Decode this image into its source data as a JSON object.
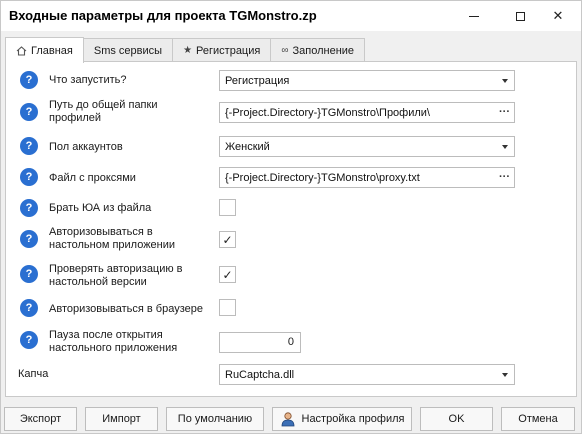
{
  "window": {
    "title": "Входные параметры для проекта TGMonstro.zp"
  },
  "tabs": [
    {
      "icon": "home-icon",
      "label": "Главная",
      "active": true
    },
    {
      "icon": "",
      "label": "Sms сервисы",
      "active": false
    },
    {
      "icon": "star-icon",
      "label": "Регистрация",
      "active": false
    },
    {
      "icon": "infinity-icon",
      "label": "Заполнение",
      "active": false
    }
  ],
  "form": {
    "run_what": {
      "label": "Что запустить?",
      "value": "Регистрация"
    },
    "profiles_path": {
      "label": "Путь до общей папки профилей",
      "value": "{-Project.Directory-}TGMonstro\\Профили\\"
    },
    "gender": {
      "label": "Пол аккаунтов",
      "value": "Женский"
    },
    "proxy_file": {
      "label": "Файл с проксями",
      "value": "{-Project.Directory-}TGMonstro\\proxy.txt"
    },
    "ua_from_file": {
      "label": "Брать ЮА из файла",
      "checked": false
    },
    "auth_desktop": {
      "label": "Авторизовываться в настольном приложении",
      "checked": true
    },
    "check_auth_desktop": {
      "label": "Проверять авторизацию в настольной версии",
      "checked": true
    },
    "auth_browser": {
      "label": "Авторизовываться в браузере",
      "checked": false
    },
    "pause_after_open": {
      "label": "Пауза после открытия настольного приложения",
      "value": "0"
    },
    "captcha": {
      "label": "Капча",
      "value": "RuCaptcha.dll"
    }
  },
  "buttons": {
    "export": "Экспорт",
    "import": "Импорт",
    "default": "По умолчанию",
    "profile_settings": "Настройка профиля",
    "ok": "OK",
    "cancel": "Отмена"
  },
  "glyphs": {
    "help": "?",
    "check": "✓",
    "ellipsis": "···",
    "close": "✕"
  }
}
